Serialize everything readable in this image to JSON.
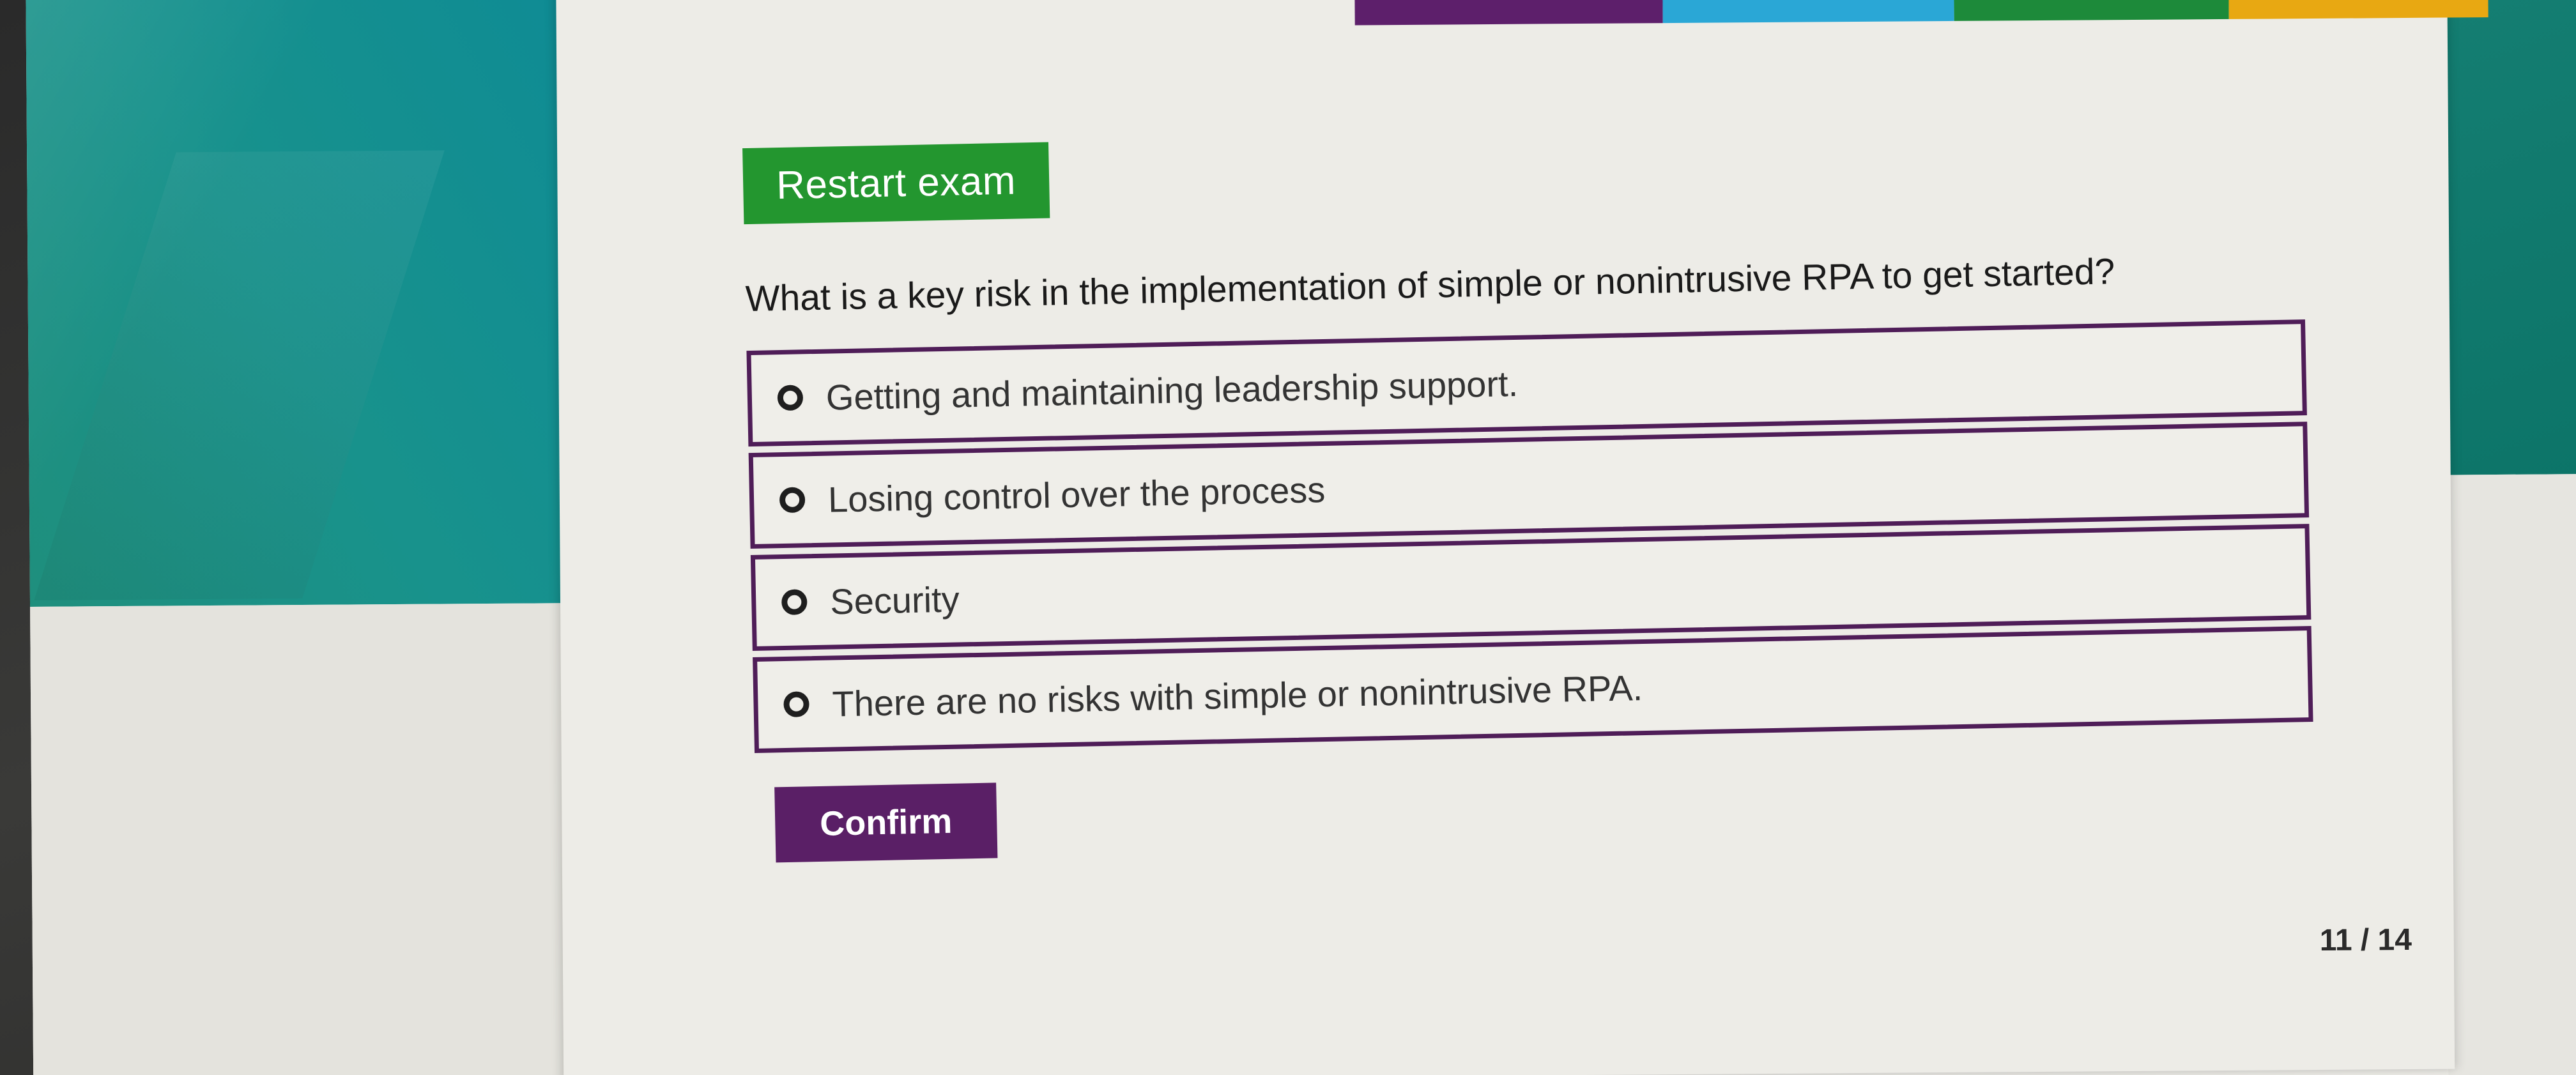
{
  "exam": {
    "restart_label": "Restart exam",
    "question": "What is a key risk in the implementation of simple or nonintrusive RPA to get started?",
    "options": [
      {
        "label": "Getting and maintaining leadership support."
      },
      {
        "label": "Losing control over the process"
      },
      {
        "label": "Security"
      },
      {
        "label": "There are no risks with simple or nonintrusive RPA."
      }
    ],
    "confirm_label": "Confirm",
    "progress": "11 / 14"
  },
  "colors": {
    "restart_button": "#23962f",
    "confirm_button": "#5a1f66",
    "option_border": "#4f1d58",
    "strip": [
      "#5d1f6b",
      "#2aa7d6",
      "#1d8a3a",
      "#e8a812"
    ]
  }
}
